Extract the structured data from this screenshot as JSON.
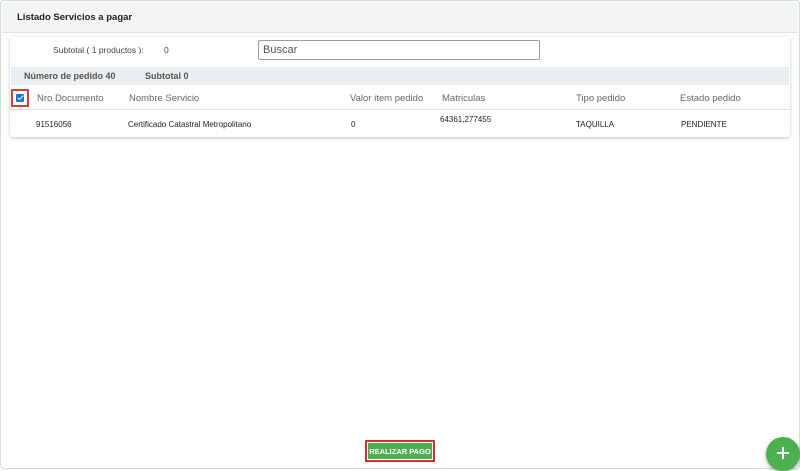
{
  "panel": {
    "title": "Listado Servicios a pagar"
  },
  "summary": {
    "subtotal_label": "Subtotal ( 1 productos ):",
    "subtotal_value": "0"
  },
  "search": {
    "placeholder": "Buscar",
    "value": ""
  },
  "order": {
    "number_label": "Número de pedido 40",
    "subtotal_label": "Subtotal 0"
  },
  "table": {
    "select_all_checked": true,
    "columns": {
      "nro_documento": "Nro Documento",
      "nombre_servicio": "Nombre Servicio",
      "valor_item": "Valor item pedido",
      "matriculas": "Matriculas",
      "tipo_pedido": "Tipo pedido",
      "estado_pedido": "Estado pedido"
    },
    "rows": [
      {
        "nro_documento": "91516056",
        "nombre_servicio": "Certificado Catastral Metropolitano",
        "valor_item": "0",
        "matriculas": "64361,277455",
        "tipo_pedido": "TAQUILLA",
        "estado_pedido": "PENDIENTE"
      }
    ]
  },
  "actions": {
    "pay_label": "REALIZAR PAGO",
    "fab_icon": "plus-icon",
    "accent_color": "#4caf50",
    "highlight_color": "#d32f2f"
  }
}
